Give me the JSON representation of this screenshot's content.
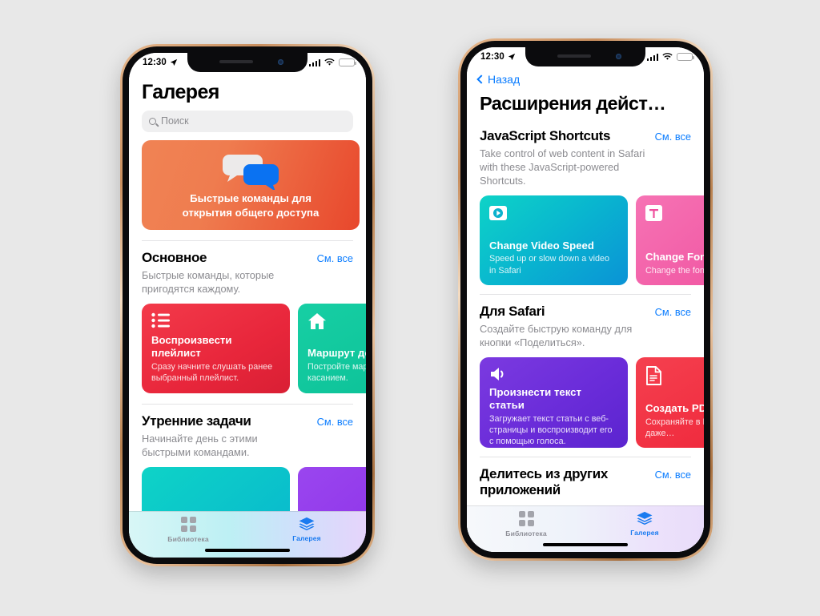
{
  "background_color": "#e8e8e8",
  "accent_color": "#0a7cff",
  "phones": [
    {
      "id": "gallery-screen",
      "status_bar": {
        "time": "12:30",
        "location_icon": "location-arrow-icon",
        "signal_icon": "cellular-bars-icon",
        "wifi_icon": "wifi-icon",
        "battery_icon": "battery-charging-icon"
      },
      "title": "Галерея",
      "search": {
        "placeholder": "Поиск",
        "icon": "search-icon"
      },
      "banner": {
        "line1": "Быстрые команды для",
        "line2": "открытия общего доступа",
        "icon": "speech-bubbles-icon",
        "color": "#ef7c4f"
      },
      "sections": [
        {
          "title": "Основное",
          "see_all": "См. все",
          "subtitle": "Быстрые команды, которые пригодятся каждому.",
          "cards": [
            {
              "title": "Воспроизвести плейлист",
              "desc": "Сразу начните слушать ранее выбранный плейлист.",
              "icon": "bullet-list-icon",
              "color": "#e8263b"
            },
            {
              "title": "Маршрут домой",
              "desc": "Постройте маршрут одним касанием.",
              "icon": "house-icon",
              "color": "#0bbf96"
            }
          ]
        },
        {
          "title": "Утренние задачи",
          "see_all": "См. все",
          "subtitle": "Начинайте день с этими быстрыми командами.",
          "cards": []
        }
      ],
      "tabs": [
        {
          "label": "Библиотека",
          "icon": "grid-icon",
          "active": false
        },
        {
          "label": "Галерея",
          "icon": "layers-icon",
          "active": true
        }
      ]
    },
    {
      "id": "action-extensions-screen",
      "status_bar": {
        "time": "12:30",
        "location_icon": "location-arrow-icon",
        "signal_icon": "cellular-bars-icon",
        "wifi_icon": "wifi-icon",
        "battery_icon": "battery-charging-icon"
      },
      "back_label": "Назад",
      "title": "Расширения дейст…",
      "sections": [
        {
          "title": "JavaScript Shortcuts",
          "see_all": "См. все",
          "subtitle": "Take control of web content in Safari with these JavaScript-powered Shortcuts.",
          "cards": [
            {
              "title": "Change Video Speed",
              "desc": "Speed up or slow down a video in Safari",
              "icon": "play-badge-icon",
              "color": "#09b6cf"
            },
            {
              "title": "Change Font",
              "desc": "Change the font",
              "icon": "text-t-icon",
              "color": "#ef4f9e"
            }
          ]
        },
        {
          "title": "Для Safari",
          "see_all": "См. все",
          "subtitle": "Создайте быструю команду для кнопки «Поделиться».",
          "cards": [
            {
              "title": "Произнести текст статьи",
              "desc": "Загружает текст статьи с веб-страницы и воспроизводит его с помощью голоса.",
              "icon": "speaker-icon",
              "color": "#6a2cd9"
            },
            {
              "title": "Создать PDF",
              "desc": "Сохраняйте в PDF данные — даже…",
              "icon": "document-icon",
              "color": "#ee2438"
            }
          ]
        },
        {
          "title": "Делитесь из других приложений",
          "see_all": "См. все",
          "subtitle": "",
          "cards": []
        }
      ],
      "tabs": [
        {
          "label": "Библиотека",
          "icon": "grid-icon",
          "active": false
        },
        {
          "label": "Галерея",
          "icon": "layers-icon",
          "active": true
        }
      ]
    }
  ]
}
